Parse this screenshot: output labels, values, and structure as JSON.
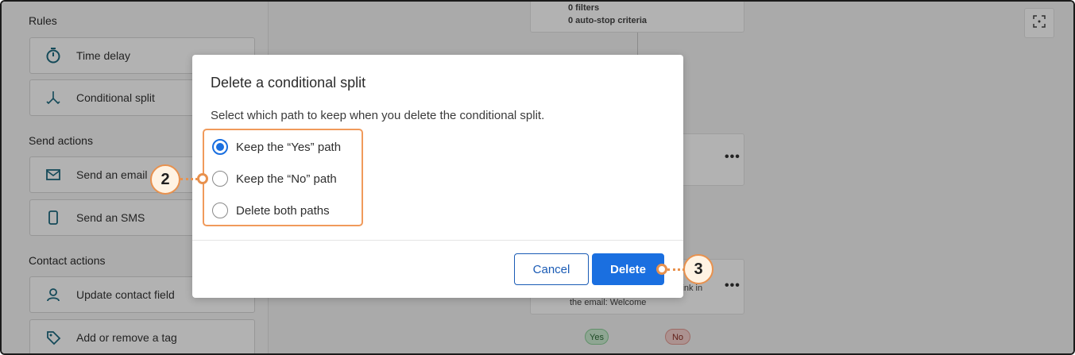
{
  "sidebar": {
    "rules_title": "Rules",
    "rules": [
      {
        "label": "Time delay",
        "icon": "stopwatch-icon"
      },
      {
        "label": "Conditional split",
        "icon": "split-arrows-icon"
      }
    ],
    "send_title": "Send actions",
    "send": [
      {
        "label": "Send an email",
        "icon": "envelope-icon"
      },
      {
        "label": "Send an SMS",
        "icon": "phone-icon"
      }
    ],
    "contact_title": "Contact actions",
    "contact": [
      {
        "label": "Update contact field",
        "icon": "person-icon"
      },
      {
        "label": "Add or remove a tag",
        "icon": "tag-icon"
      }
    ]
  },
  "canvas": {
    "top_node": {
      "line1": "0 filters",
      "line2": "0 auto-stop criteria"
    },
    "lower_node": {
      "line1": "link in",
      "line2": "the email: Welcome"
    },
    "yes_label": "Yes",
    "no_label": "No",
    "more_label": "•••"
  },
  "dialog": {
    "title": "Delete a conditional split",
    "description": "Select which path to keep when you delete the conditional split.",
    "options": [
      {
        "label": "Keep the “Yes” path",
        "checked": true
      },
      {
        "label": "Keep the “No” path",
        "checked": false
      },
      {
        "label": "Delete both paths",
        "checked": false
      }
    ],
    "cancel_label": "Cancel",
    "delete_label": "Delete"
  },
  "callouts": {
    "step_options": "2",
    "step_delete": "3"
  },
  "colors": {
    "accent": "#1a6fe0",
    "callout": "#e8914e",
    "yes": "#cdeed3",
    "no": "#f6d2cf"
  }
}
